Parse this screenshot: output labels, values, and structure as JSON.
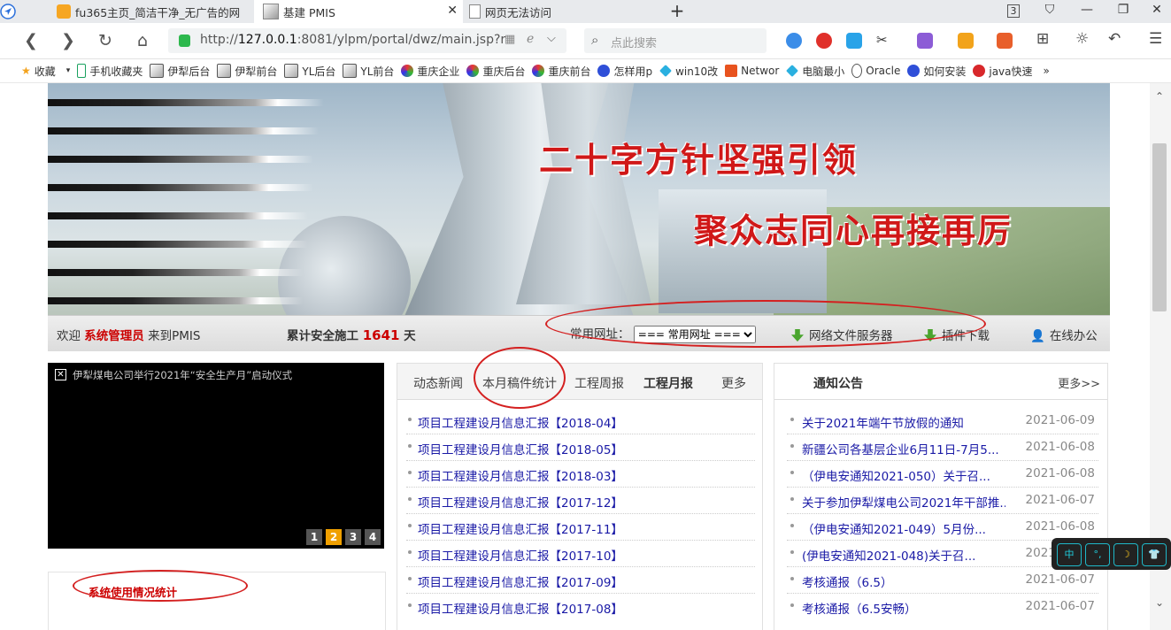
{
  "tabs": [
    {
      "label": "fu365主页_简洁干净_无广告的网",
      "active": false
    },
    {
      "label": "基建 PMIS",
      "active": true
    },
    {
      "label": "网页无法访问",
      "active": false
    }
  ],
  "window": {
    "tab_count": "3",
    "new_tab": "+"
  },
  "address": {
    "url_prefix": "http://",
    "url_host": "127.0.0.1",
    "url_rest": ":8081/ylpm/portal/dwz/main.jsp?r",
    "search_placeholder": "点此搜索"
  },
  "bookmarks": [
    "收藏",
    "手机收藏夹",
    "伊犁后台",
    "伊犁前台",
    "YL后台",
    "YL前台",
    "重庆企业",
    "重庆后台",
    "重庆前台",
    "怎样用p",
    "win10改",
    "Networ",
    "电脑最小",
    "Oracle",
    "如何安装",
    "java快速"
  ],
  "banner": {
    "slogan1": "二十字方针坚强引领",
    "slogan2": "聚众志同心再接再厉"
  },
  "infobar": {
    "welcome": "欢迎",
    "user": "系统管理员",
    "to_pmis": "来到PMIS",
    "safety_label": "累计安全施工",
    "safety_days": "1641",
    "safety_unit": "天",
    "links_label": "常用网址：",
    "links_select": "=== 常用网址 ===",
    "file_server": "网络文件服务器",
    "plugin_download": "插件下载",
    "online_office": "在线办公"
  },
  "slider": {
    "title": "伊犁煤电公司举行2021年“安全生产月”启动仪式",
    "pages": [
      "1",
      "2",
      "3",
      "4"
    ],
    "current": "2"
  },
  "stats": {
    "title": "系统使用情况统计"
  },
  "news": {
    "tabs": [
      "动态新闻",
      "本月稿件统计",
      "工程周报",
      "工程月报",
      "更多"
    ],
    "items": [
      "项目工程建设月信息汇报【2018-04】",
      "项目工程建设月信息汇报【2018-05】",
      "项目工程建设月信息汇报【2018-03】",
      "项目工程建设月信息汇报【2017-12】",
      "项目工程建设月信息汇报【2017-11】",
      "项目工程建设月信息汇报【2017-10】",
      "项目工程建设月信息汇报【2017-09】",
      "项目工程建设月信息汇报【2017-08】"
    ]
  },
  "notice": {
    "title": "通知公告",
    "more": "更多>>",
    "items": [
      {
        "title": "关于2021年端午节放假的通知",
        "date": "2021-06-09"
      },
      {
        "title": "新疆公司各基层企业6月11日-7月5...",
        "date": "2021-06-08"
      },
      {
        "title": "（伊电安通知2021-050）关于召...",
        "date": "2021-06-08"
      },
      {
        "title": "关于参加伊犁煤电公司2021年干部推...",
        "date": "2021-06-07"
      },
      {
        "title": "（伊电安通知2021-049）5月份...",
        "date": "2021-06-08"
      },
      {
        "title": "(伊电安通知2021-048)关于召...",
        "date": "2021-06-07"
      },
      {
        "title": "考核通报（6.5）",
        "date": "2021-06-07"
      },
      {
        "title": "考核通报（6.5安畅）",
        "date": "2021-06-07"
      }
    ]
  },
  "ime": {
    "buttons": [
      "中",
      "°,",
      "☽",
      "👕"
    ]
  },
  "colors": {
    "accent_red": "#c00000",
    "link_blue": "#1a1aa6"
  }
}
